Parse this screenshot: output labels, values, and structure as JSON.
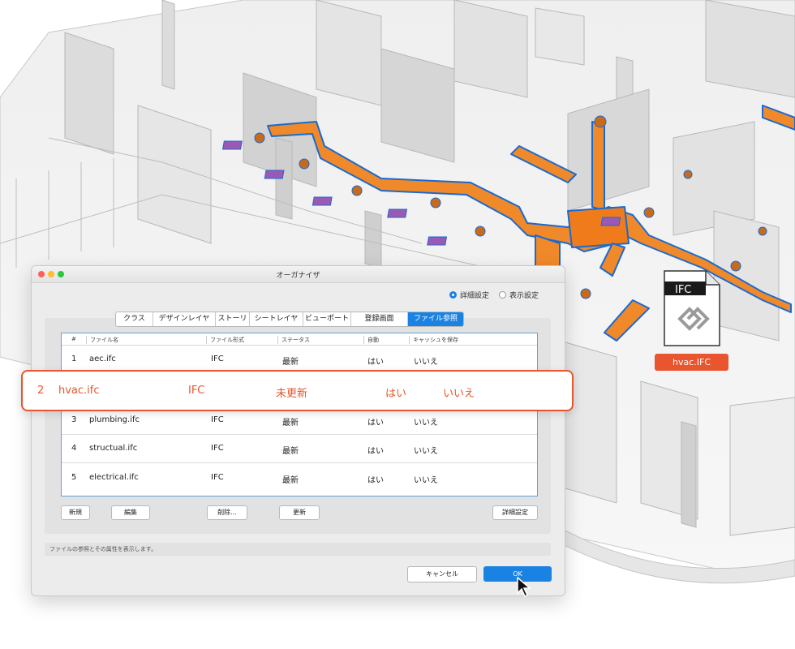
{
  "dialog": {
    "title": "オーガナイザ",
    "radio_advanced": "詳細設定",
    "radio_display": "表示設定",
    "tabs": [
      "クラス",
      "デザインレイヤ",
      "ストーリ",
      "シートレイヤ",
      "ビューポート",
      "登録画面",
      "ファイル参照"
    ],
    "active_tab": "ファイル参照",
    "columns": [
      "#",
      "ファイル名",
      "ファイル形式",
      "ステータス",
      "自動",
      "キャッシュを保存"
    ],
    "rows": [
      {
        "num": "1",
        "name": "aec.ifc",
        "format": "IFC",
        "status": "最新",
        "auto": "はい",
        "cache": "いいえ"
      },
      {
        "num": "3",
        "name": "plumbing.ifc",
        "format": "IFC",
        "status": "最新",
        "auto": "はい",
        "cache": "いいえ"
      },
      {
        "num": "4",
        "name": "structual.ifc",
        "format": "IFC",
        "status": "最新",
        "auto": "はい",
        "cache": "いいえ"
      },
      {
        "num": "5",
        "name": "electrical.ifc",
        "format": "IFC",
        "status": "最新",
        "auto": "はい",
        "cache": "いいえ"
      }
    ],
    "buttons": {
      "new": "新規",
      "edit": "編集",
      "delete": "削除...",
      "update": "更新",
      "details": "詳細設定"
    },
    "status_text": "ファイルの参照とその属性を表示します。",
    "cancel": "キャンセル",
    "ok": "OK"
  },
  "highlight_row": {
    "num": "2",
    "name": "hvac.ifc",
    "format": "IFC",
    "status": "未更新",
    "auto": "はい",
    "cache": "いいえ"
  },
  "file_icon": {
    "badge": "IFC",
    "label": "hvac.IFC"
  },
  "colors": {
    "accent": "#e8552e",
    "selection": "#1a82e2",
    "duct": "#f0892a"
  }
}
